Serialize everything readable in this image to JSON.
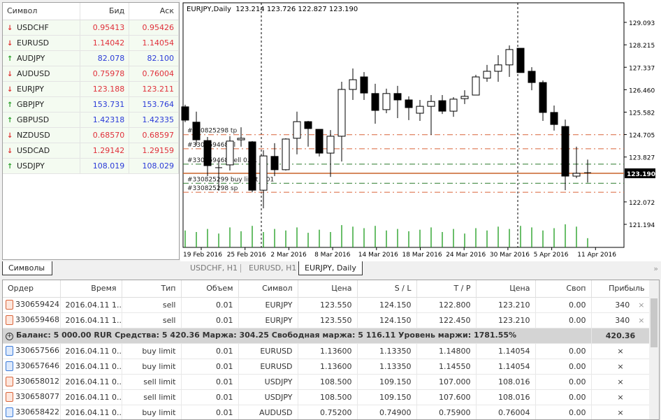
{
  "market_watch": {
    "headers": [
      "Символ",
      "Бид",
      "Аск"
    ],
    "rows": [
      {
        "symbol": "USDCHF",
        "bid": "0.95413",
        "ask": "0.95426",
        "dir": "down"
      },
      {
        "symbol": "EURUSD",
        "bid": "1.14042",
        "ask": "1.14054",
        "dir": "down"
      },
      {
        "symbol": "AUDJPY",
        "bid": "82.078",
        "ask": "82.100",
        "dir": "up"
      },
      {
        "symbol": "AUDUSD",
        "bid": "0.75978",
        "ask": "0.76004",
        "dir": "down"
      },
      {
        "symbol": "EURJPY",
        "bid": "123.188",
        "ask": "123.211",
        "dir": "down"
      },
      {
        "symbol": "GBPJPY",
        "bid": "153.731",
        "ask": "153.764",
        "dir": "up"
      },
      {
        "symbol": "GBPUSD",
        "bid": "1.42318",
        "ask": "1.42335",
        "dir": "up"
      },
      {
        "symbol": "NZDUSD",
        "bid": "0.68570",
        "ask": "0.68597",
        "dir": "down"
      },
      {
        "symbol": "USDCAD",
        "bid": "1.29142",
        "ask": "1.29159",
        "dir": "down"
      },
      {
        "symbol": "USDJPY",
        "bid": "108.019",
        "ask": "108.029",
        "dir": "up"
      }
    ],
    "tab": "Символы"
  },
  "chart": {
    "title": "EURJPY,Daily  123.214 123.726 122.827 123.190",
    "current_price": "123.190",
    "price_labels": [
      "129.093",
      "128.215",
      "127.337",
      "126.460",
      "125.582",
      "124.705",
      "123.827",
      "122.950",
      "122.072",
      "121.194"
    ],
    "date_labels": [
      "19 Feb 2016",
      "25 Feb 2016",
      "2 Mar 2016",
      "8 Mar 2016",
      "14 Mar 2016",
      "18 Mar 2016",
      "24 Mar 2016",
      "30 Mar 2016",
      "5 Apr 2016",
      "11 Apr 2016"
    ],
    "ohlc": [
      [
        125.79,
        125.87,
        125.19,
        125.27
      ],
      [
        125.19,
        125.6,
        124.28,
        124.5
      ],
      [
        124.47,
        124.61,
        123.08,
        123.49
      ],
      [
        123.41,
        123.65,
        122.51,
        123.41
      ],
      [
        123.52,
        124.64,
        123.3,
        124.45
      ],
      [
        124.5,
        124.99,
        124.23,
        124.56
      ],
      [
        124.42,
        124.45,
        122.45,
        122.53
      ],
      [
        122.53,
        124.09,
        121.82,
        123.87
      ],
      [
        123.85,
        124.37,
        123.08,
        123.33
      ],
      [
        123.33,
        124.56,
        123.3,
        124.53
      ],
      [
        124.56,
        125.6,
        123.93,
        125.21
      ],
      [
        125.21,
        125.24,
        124.23,
        124.94
      ],
      [
        124.91,
        124.91,
        123.85,
        123.98
      ],
      [
        123.98,
        124.88,
        123.05,
        124.64
      ],
      [
        124.64,
        126.77,
        123.65,
        126.47
      ],
      [
        126.47,
        127.29,
        126.06,
        126.85
      ],
      [
        126.96,
        127.15,
        126.06,
        126.33
      ],
      [
        126.31,
        126.69,
        125.13,
        125.65
      ],
      [
        125.68,
        126.5,
        125.54,
        126.31
      ],
      [
        126.31,
        126.61,
        125.35,
        126.06
      ],
      [
        126.06,
        126.2,
        125.27,
        125.76
      ],
      [
        125.54,
        126.06,
        125.24,
        125.81
      ],
      [
        125.81,
        126.25,
        124.69,
        126.0
      ],
      [
        126.03,
        126.25,
        125.51,
        125.62
      ],
      [
        125.62,
        126.17,
        125.4,
        126.09
      ],
      [
        126.11,
        126.44,
        125.9,
        126.2
      ],
      [
        126.25,
        127.04,
        126.25,
        126.96
      ],
      [
        126.91,
        127.43,
        126.77,
        127.18
      ],
      [
        127.18,
        127.81,
        126.77,
        127.43
      ],
      [
        127.43,
        128.19,
        126.96,
        128.03
      ],
      [
        128.08,
        128.08,
        127.13,
        127.13
      ],
      [
        127.18,
        127.34,
        126.44,
        126.74
      ],
      [
        126.74,
        126.82,
        125.24,
        125.57
      ],
      [
        125.57,
        125.84,
        124.86,
        125.1
      ],
      [
        125.02,
        125.29,
        122.53,
        123.08
      ],
      [
        123.08,
        124.23,
        123.0,
        123.19
      ],
      [
        123.214,
        123.726,
        122.827,
        123.19
      ]
    ],
    "volumes": [
      22,
      20,
      24,
      18,
      26,
      21,
      28,
      20,
      24,
      22,
      26,
      19,
      23,
      20,
      29,
      27,
      25,
      28,
      22,
      24,
      21,
      23,
      26,
      20,
      24,
      18,
      25,
      22,
      27,
      24,
      28,
      26,
      22,
      25,
      30,
      27,
      12
    ],
    "order_lines": [
      {
        "price": 124.7,
        "label": "#330825298 tp",
        "color": "#d9643a"
      },
      {
        "price": 124.15,
        "label": "#330659468 sl",
        "color": "#d9643a"
      },
      {
        "price": 123.55,
        "label": "#330659468 sell 0.01",
        "color": "#2a7a2a"
      },
      {
        "price": 122.8,
        "label": "#330825299 buy limit 0.01",
        "color": "#2a7a2a"
      },
      {
        "price": 122.45,
        "label": "#330825298 sp",
        "color": "#d9643a"
      }
    ]
  },
  "chart_tabs": [
    "USDCHF, H1",
    "EURUSD, H1",
    "EURJPY, Daily"
  ],
  "more": "»",
  "orders": {
    "headers": [
      "Ордер",
      "Время",
      "Тип",
      "Объем",
      "Символ",
      "Цена",
      "S / L",
      "T / P",
      "Цена",
      "Своп",
      "Прибыль"
    ],
    "open": [
      {
        "id": "330659424",
        "time": "2016.04.11 1...",
        "type": "sell",
        "vol": "0.01",
        "sym": "EURJPY",
        "price": "123.550",
        "sl": "124.150",
        "tp": "122.800",
        "cur": "123.210",
        "swap": "0.00",
        "profit": "340",
        "kind": "sell"
      },
      {
        "id": "330659468",
        "time": "2016.04.11 1...",
        "type": "sell",
        "vol": "0.01",
        "sym": "EURJPY",
        "price": "123.550",
        "sl": "124.150",
        "tp": "122.450",
        "cur": "123.210",
        "swap": "0.00",
        "profit": "340",
        "kind": "sell"
      }
    ],
    "summary": {
      "text": "Баланс: 5 000.00 RUR  Средства: 5 420.36  Маржа: 304.25  Свободная маржа: 5 116.11  Уровень маржи: 1781.55%",
      "profit": "420.36"
    },
    "pending": [
      {
        "id": "330657566",
        "time": "2016.04.11 0...",
        "type": "buy limit",
        "vol": "0.01",
        "sym": "EURUSD",
        "price": "1.13600",
        "sl": "1.13350",
        "tp": "1.14800",
        "cur": "1.14054",
        "swap": "0.00",
        "kind": "buy"
      },
      {
        "id": "330657646",
        "time": "2016.04.11 0...",
        "type": "buy limit",
        "vol": "0.01",
        "sym": "EURUSD",
        "price": "1.13600",
        "sl": "1.13350",
        "tp": "1.14550",
        "cur": "1.14054",
        "swap": "0.00",
        "kind": "buy"
      },
      {
        "id": "330658012",
        "time": "2016.04.11 0...",
        "type": "sell limit",
        "vol": "0.01",
        "sym": "USDJPY",
        "price": "108.500",
        "sl": "109.150",
        "tp": "107.000",
        "cur": "108.016",
        "swap": "0.00",
        "kind": "sell"
      },
      {
        "id": "330658077",
        "time": "2016.04.11 0...",
        "type": "sell limit",
        "vol": "0.01",
        "sym": "USDJPY",
        "price": "108.500",
        "sl": "109.150",
        "tp": "107.600",
        "cur": "108.016",
        "swap": "0.00",
        "kind": "sell"
      },
      {
        "id": "330658422",
        "time": "2016.04.11 0...",
        "type": "buy limit",
        "vol": "0.01",
        "sym": "AUDUSD",
        "price": "0.75200",
        "sl": "0.74900",
        "tp": "0.75900",
        "cur": "0.76004",
        "swap": "0.00",
        "kind": "buy"
      }
    ],
    "close_symbol": "×"
  }
}
